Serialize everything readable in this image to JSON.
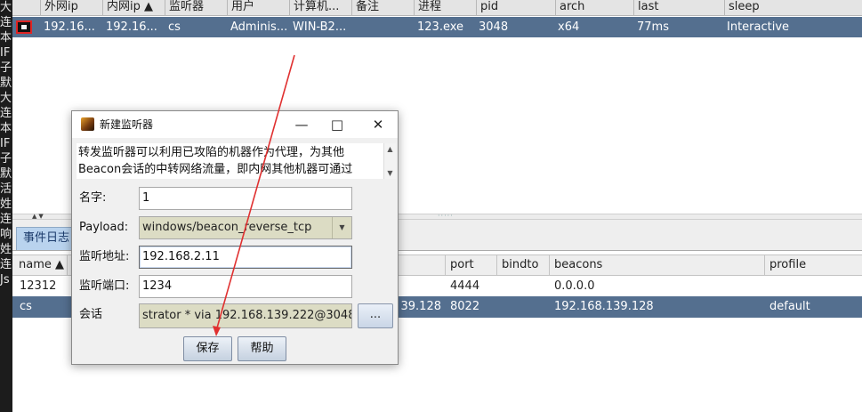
{
  "left_strip_chars": [
    "大",
    "",
    "连",
    "本",
    "IF",
    "子",
    "默",
    "",
    "大",
    "",
    "连",
    "本",
    "IF",
    "子",
    "默",
    "",
    "活",
    "",
    "姓",
    "连",
    "",
    "响",
    "",
    "姓",
    "连",
    "",
    "Js"
  ],
  "beacons": {
    "columns": [
      "外网ip",
      "内网ip ▲",
      "监听器",
      "用户",
      "计算机...",
      "备注",
      "进程",
      "pid",
      "arch",
      "last",
      "sleep"
    ],
    "row": {
      "external": "192.16...",
      "internal": "192.16...",
      "listener": "cs",
      "user": "Adminis...",
      "computer": "WIN-B2...",
      "note": "",
      "process": "123.exe",
      "pid": "3048",
      "arch": "x64",
      "last": "77ms",
      "sleep": "Interactive"
    }
  },
  "tab": {
    "label": "事件日志"
  },
  "listeners": {
    "columns": [
      "name ▲",
      "port",
      "bindto",
      "beacons",
      "profile"
    ],
    "rows": [
      {
        "name": "12312",
        "host": "",
        "port": "4444",
        "bindto": "",
        "beacons": "0.0.0.0",
        "profile": ""
      },
      {
        "name": "cs",
        "host": "39.128",
        "port": "8022",
        "bindto": "",
        "beacons": "192.168.139.128",
        "profile": "default"
      }
    ]
  },
  "dialog": {
    "title": "新建监听器",
    "description": "转发监听器可以利用已攻陷的机器作为代理，为其他Beacon会话的中转网络流量，即内网其他机器可通过",
    "name_label": "名字:",
    "name_value": "1",
    "payload_label": "Payload:",
    "payload_value": "windows/beacon_reverse_tcp",
    "address_label": "监听地址:",
    "address_value": "192.168.2.11",
    "port_label": "监听端口:",
    "port_value": "1234",
    "session_label": "会话",
    "session_value": "strator * via  192.168.139.222@3048",
    "browse_label": "...",
    "save_label": "保存",
    "help_label": "帮助",
    "minimize_glyph": "—",
    "maximize_glyph": "□",
    "close_glyph": "✕"
  },
  "colors": {
    "selection": "#546f8f",
    "annotation_arrow": "#e03030",
    "combo_fill": "#dcdcc4"
  }
}
